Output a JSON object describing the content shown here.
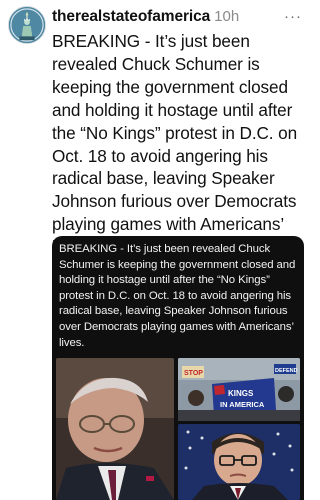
{
  "post": {
    "username": "therealstateofamerica",
    "timestamp": "10h",
    "more_label": "···",
    "text": "BREAKING - It’s just been revealed Chuck Schumer is keeping the government closed and holding it hostage until after the “No Kings” protest in D.C. on Oct. 18 to avoid angering his radical base, leaving Speaker Johnson furious over Democrats playing games with Americans’ lives.",
    "avatar_icon": "statue-of-liberty-icon"
  },
  "embed": {
    "text": "BREAKING - It’s just been revealed Chuck Schumer is keeping the government closed and holding it hostage until after the “No Kings” protest in D.C. on Oct. 18 to avoid angering his radical base, leaving Speaker Johnson furious over Democrats playing games with Americans’ lives.",
    "protest_sign_text": "KINGS\nIN AMERICA",
    "protest_sign_top": "STOP",
    "protest_sign_right": "DEFEND",
    "background_color": "#0f0f10"
  }
}
